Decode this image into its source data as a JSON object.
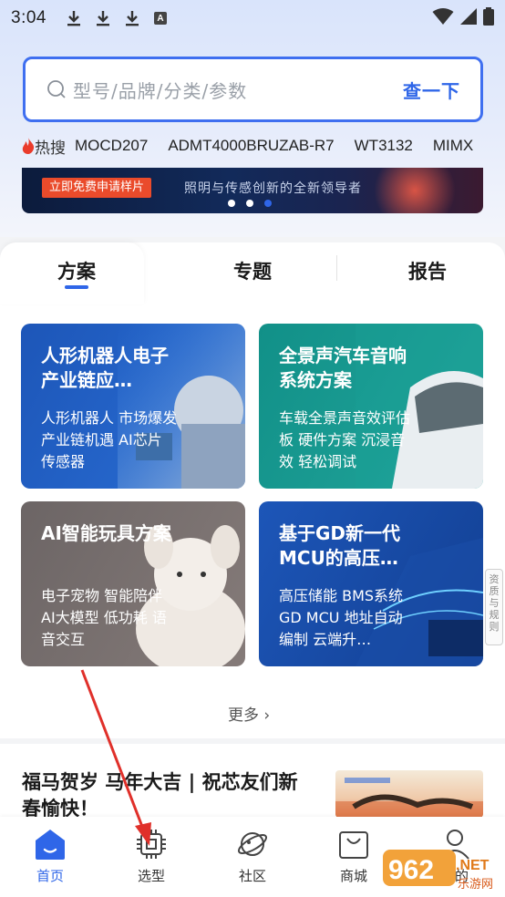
{
  "status_bar": {
    "time": "3:04",
    "notification_badge": "A"
  },
  "search": {
    "placeholder": "型号/品牌/分类/参数",
    "button_label": "查一下"
  },
  "hot_search": {
    "label": "热搜",
    "items": [
      "MOCD207",
      "ADMT4000BRUZAB-R7",
      "WT3132",
      "MIMX"
    ]
  },
  "banner": {
    "cta_label": "立即免费申请样片",
    "slogan": "照明与传感创新的全新领导者",
    "active_dot": 2,
    "dot_count": 3
  },
  "tabs": [
    {
      "label": "方案",
      "active": true
    },
    {
      "label": "专题",
      "active": false
    },
    {
      "label": "报告",
      "active": false
    }
  ],
  "cards": [
    {
      "title": "人形机器人电子产业链应…",
      "desc": "人形机器人 市场爆发 产业链机遇 AI芯片 传感器",
      "color": "#1f5cbf"
    },
    {
      "title": "全景声汽车音响系统方案",
      "desc": "车载全景声音效评估板 硬件方案 沉浸音效 轻松调试",
      "color": "#16938f"
    },
    {
      "title": "AI智能玩具方案",
      "desc": "电子宠物 智能陪伴 AI大模型 低功耗 语音交互",
      "color": "#6e6868"
    },
    {
      "title": "基于GD新一代MCU的高压…",
      "desc": "高压储能 BMS系统 GD MCU 地址自动编制 云端升…",
      "color": "#1f5cbf"
    }
  ],
  "more_label": "更多",
  "side_tag": "资质与规则",
  "news": {
    "title": "福马贺岁 马年大吉 | 祝芯友们新春愉快！"
  },
  "bottom_nav": [
    {
      "label": "首页",
      "icon": "home-icon",
      "active": true
    },
    {
      "label": "选型",
      "icon": "chip-icon",
      "active": false
    },
    {
      "label": "社区",
      "icon": "planet-icon",
      "active": false
    },
    {
      "label": "商城",
      "icon": "shopping-bag-icon",
      "active": false
    },
    {
      "label": "我的",
      "icon": "user-icon",
      "active": false
    }
  ],
  "watermark": {
    "text": "962",
    "suffix": ".NET",
    "sub": "乐游网"
  },
  "colors": {
    "accent": "#2f66e8",
    "annotation_arrow": "#e0302a"
  }
}
